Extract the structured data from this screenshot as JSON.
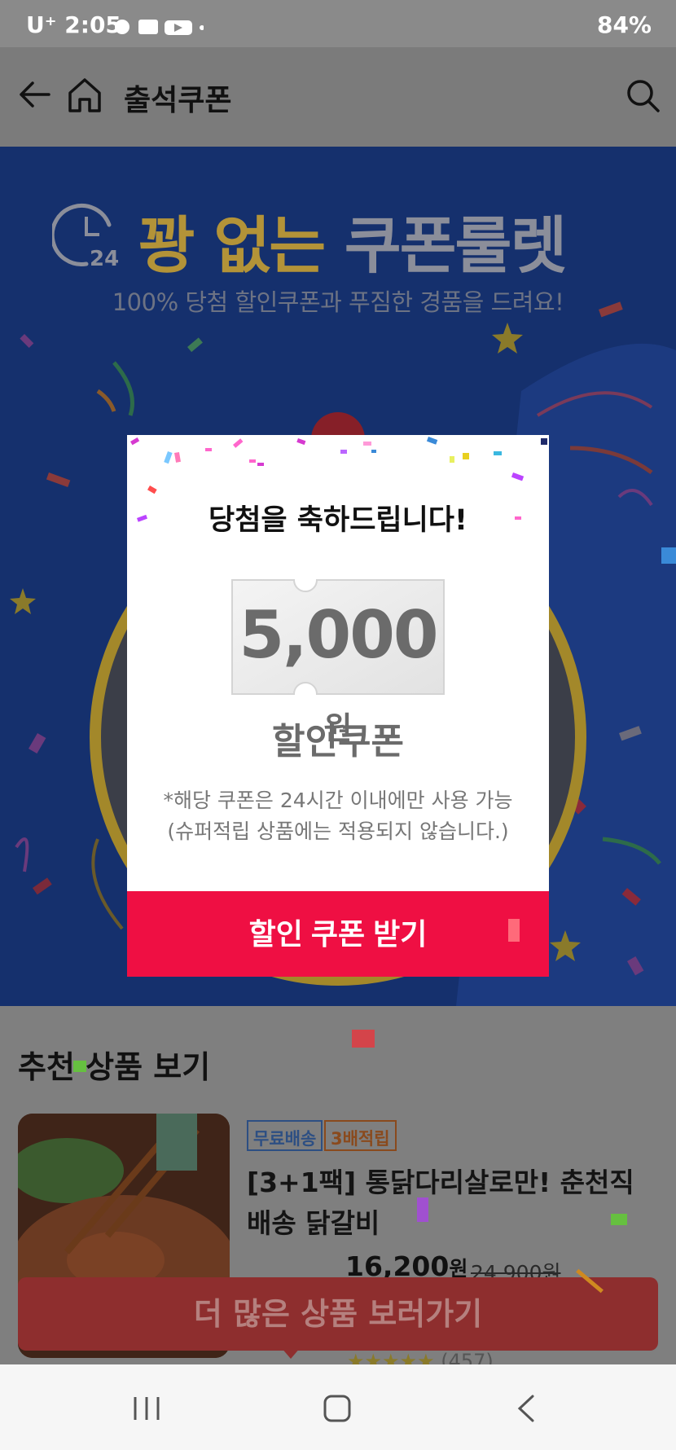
{
  "status_bar": {
    "left_text": "U⁺ 2:05",
    "battery": "84%"
  },
  "app_bar": {
    "title": "출석쿠폰",
    "icons": [
      "back-arrow-icon",
      "home-icon",
      "search-icon"
    ]
  },
  "banner": {
    "headline_gold": "꽝 없는",
    "headline_grey": "쿠폰룰렛",
    "subtitle": "100% 당첨 할인쿠폰과 푸짐한 경품을 드려요!",
    "clock_label": "24"
  },
  "modal": {
    "title": "당첨을 축하드립니다!",
    "amount": "5,000",
    "unit": "원",
    "coupon_type": "할인쿠폰",
    "note_line1": "*해당 쿠폰은 24시간 이내에만 사용 가능",
    "note_line2": "(슈퍼적립 상품에는 적용되지 않습니다.)",
    "claim_button": "할인 쿠폰 받기"
  },
  "recommendations": {
    "title": "추천 상품 보기",
    "product": {
      "badge_free_shipping": "무료배송",
      "badge_points": "3배적립",
      "name": "[3+1팩] 통닭다리살로만! 춘천직배송 닭갈비",
      "price": "16,200",
      "price_unit": "원",
      "original_price": "24,900원",
      "rating_count": "(457)"
    }
  },
  "more_button": "더 많은 상품 보러가기",
  "colors": {
    "claim_button": "#ef0f43",
    "banner_bg": "#15306d",
    "overlay_gold": "#b39338"
  }
}
